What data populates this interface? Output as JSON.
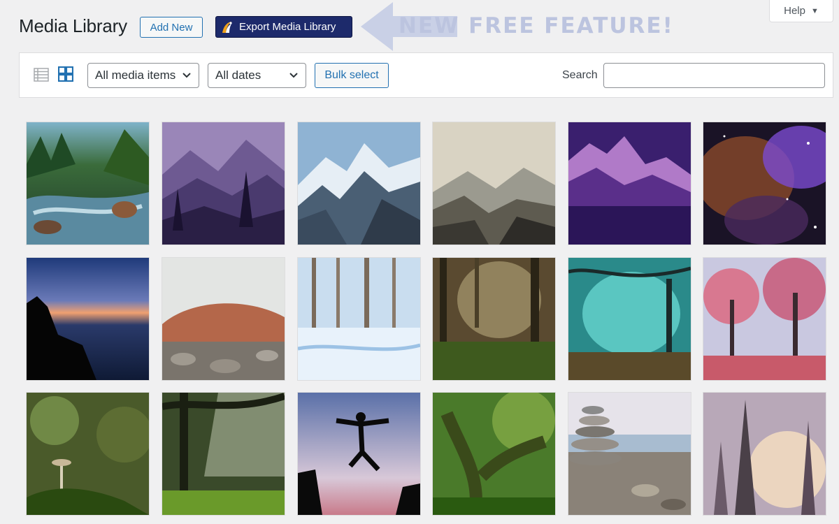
{
  "header": {
    "title": "Media Library",
    "add_new_label": "Add New",
    "export_label": "Export Media Library",
    "promo_text": "NEW FREE FEATURE!",
    "help_label": "Help"
  },
  "toolbar": {
    "media_filter": "All media items",
    "date_filter": "All dates",
    "bulk_select_label": "Bulk select",
    "search_label": "Search",
    "search_value": "",
    "active_view": "grid"
  },
  "colors": {
    "accent": "#2271b1",
    "export_button": "#1d2a6b",
    "promo": "#bcc4df"
  },
  "media": [
    {
      "subject": "forest river rapids"
    },
    {
      "subject": "purple mountain silhouette illustration"
    },
    {
      "subject": "snowy mountain peaks"
    },
    {
      "subject": "misty mountain valley"
    },
    {
      "subject": "purple mountain at dusk"
    },
    {
      "subject": "colorful nebula in space"
    },
    {
      "subject": "coastal sunset with cottage silhouette"
    },
    {
      "subject": "red rock mound in fog"
    },
    {
      "subject": "snowy winter forest"
    },
    {
      "subject": "misty green forest path"
    },
    {
      "subject": "magical turquoise forest"
    },
    {
      "subject": "pink blossom trees"
    },
    {
      "subject": "mushroom on moss"
    },
    {
      "subject": "sunbeams through forest"
    },
    {
      "subject": "person jumping between cliffs"
    },
    {
      "subject": "old mossy tree"
    },
    {
      "subject": "stacked stones on pebble beach"
    },
    {
      "subject": "sunrise in pine forest"
    }
  ]
}
